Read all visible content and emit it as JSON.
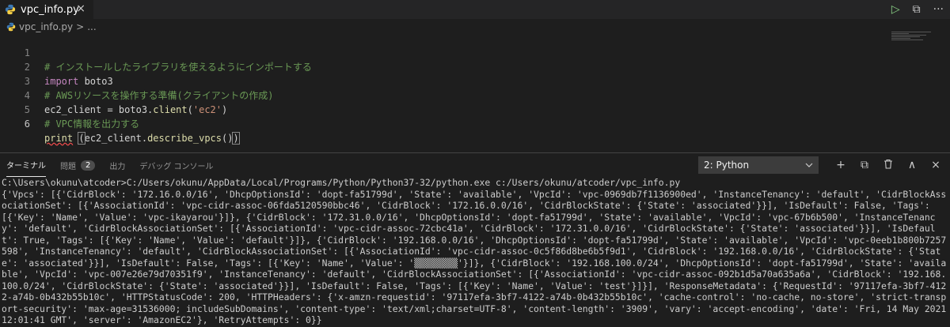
{
  "tab": {
    "filename": "vpc_info.py",
    "close": "×"
  },
  "editor_actions": {
    "run": "▷",
    "split": "⧉",
    "more": "···"
  },
  "breadcrumb": {
    "file": "vpc_info.py",
    "sep": ">",
    "rest": "..."
  },
  "code": {
    "lines": [
      {
        "num": "1",
        "comment": "# インストールしたライブラリを使えるようにインポートする"
      },
      {
        "num": "2",
        "kw": "import",
        "rest": " boto3"
      },
      {
        "num": "3",
        "comment": "# AWSリソースを操作する準備(クライアントの作成)"
      },
      {
        "num": "4",
        "a": "ec2_client = boto3.",
        "fn": "client",
        "b": "(",
        "str": "'ec2'",
        "c": ")"
      },
      {
        "num": "5",
        "comment": "# VPC情報を出力する"
      },
      {
        "num": "6",
        "fn": "print",
        "a": " ",
        "b": "(",
        "c": "ec2_client.",
        "fn2": "describe_vpcs",
        "d": "()",
        "e": ")"
      }
    ]
  },
  "panel": {
    "tabs": {
      "terminal": "ターミナル",
      "problems": "問題",
      "problems_count": "2",
      "output": "出力",
      "debug_console": "デバッグ コンソール"
    },
    "shell_select": "2: Python",
    "actions": {
      "add": "+",
      "split": "⧉",
      "trash": "🗑",
      "up": "∧",
      "close": "×"
    }
  },
  "terminal": {
    "command": "C:\\Users\\okunu\\atcoder>C:/Users/okunu/AppData/Local/Programs/Python/Python37-32/python.exe c:/Users/okunu/atcoder/vpc_info.py",
    "output": "{'Vpcs': [{'CidrBlock': '172.16.0.0/16', 'DhcpOptionsId': 'dopt-fa51799d', 'State': 'available', 'VpcId': 'vpc-0969db7f1136900ed', 'InstanceTenancy': 'default', 'CidrBlockAssociationSet': [{'AssociationId': 'vpc-cidr-assoc-06fda5120590bbc46', 'CidrBlock': '172.16.0.0/16', 'CidrBlockState': {'State': 'associated'}}], 'IsDefault': False, 'Tags': [{'Key': 'Name', 'Value': 'vpc-ikayarou'}]}, {'CidrBlock': '172.31.0.0/16', 'DhcpOptionsId': 'dopt-fa51799d', 'State': 'available', 'VpcId': 'vpc-67b6b500', 'InstanceTenancy': 'default', 'CidrBlockAssociationSet': [{'AssociationId': 'vpc-cidr-assoc-72cbc41a', 'CidrBlock': '172.31.0.0/16', 'CidrBlockState': {'State': 'associated'}}], 'IsDefault': True, 'Tags': [{'Key': 'Name', 'Value': 'default'}]}, {'CidrBlock': '192.168.0.0/16', 'DhcpOptionsId': 'dopt-fa51799d', 'State': 'available', 'VpcId': 'vpc-0eeb1b800b7257598', 'InstanceTenancy': 'default', 'CidrBlockAssociationSet': [{'AssociationId': 'vpc-cidr-assoc-0c5f86d8be6b5f9d1', 'CidrBlock': '192.168.0.0/16', 'CidrBlockState': {'State': 'associated'}}], 'IsDefault': False, 'Tags': [{'Key': 'Name', 'Value': '▒▒▒▒▒▒▒▒'}]}, {'CidrBlock': '192.168.100.0/24', 'DhcpOptionsId': 'dopt-fa51799d', 'State': 'available', 'VpcId': 'vpc-007e26e79d70351f9', 'InstanceTenancy': 'default', 'CidrBlockAssociationSet': [{'AssociationId': 'vpc-cidr-assoc-092b1d5a70a635a6a', 'CidrBlock': '192.168.100.0/24', 'CidrBlockState': {'State': 'associated'}}], 'IsDefault': False, 'Tags': [{'Key': 'Name', 'Value': 'test'}]}], 'ResponseMetadata': {'RequestId': '97117efa-3bf7-4122-a74b-0b432b55b10c', 'HTTPStatusCode': 200, 'HTTPHeaders': {'x-amzn-requestid': '97117efa-3bf7-4122-a74b-0b432b55b10c', 'cache-control': 'no-cache, no-store', 'strict-transport-security': 'max-age=31536000; includeSubDomains', 'content-type': 'text/xml;charset=UTF-8', 'content-length': '3909', 'vary': 'accept-encoding', 'date': 'Fri, 14 May 2021 12:01:41 GMT', 'server': 'AmazonEC2'}, 'RetryAttempts': 0}}"
  }
}
